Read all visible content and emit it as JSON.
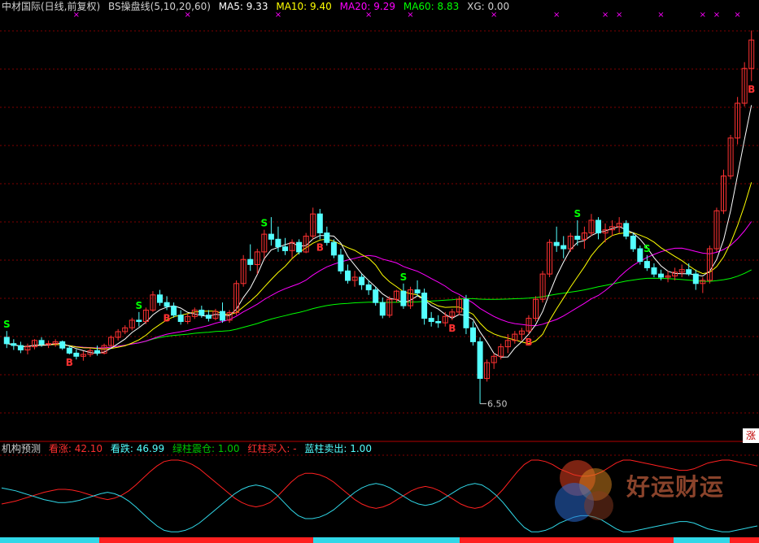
{
  "header": {
    "stock": "中材国际(日线,前复权)",
    "indicator": "BS操盘线(5,10,20,60)",
    "ma5": "MA5: 9.33",
    "ma10": "MA10: 9.40",
    "ma20": "MA20: 9.29",
    "ma60": "MA60: 8.83",
    "xg": "XG: 0.00"
  },
  "subpanel": {
    "title": "机构预测",
    "kanzhang": "看涨: 42.10",
    "kandie": "看跌: 46.99",
    "green_bar": "绿柱震仓: 1.00",
    "red_bar": "红柱买入: -",
    "blue_bar": "蓝柱卖出: 1.00"
  },
  "annotations": {
    "low_price": "6.50",
    "buy_label": "B",
    "sell_label": "S",
    "x_mark": "×",
    "zhang_button": "涨"
  },
  "watermark": {
    "text": "好运财运"
  },
  "colors": {
    "up": "#ff3232",
    "down": "#54ffff",
    "ma5": "#ffffff",
    "ma10": "#ffff00",
    "ma20": "#ff00ff",
    "ma60": "#00ff00",
    "label_b": "#ff3232",
    "label_s": "#00ff00",
    "grid": "#800000",
    "sub_red": "#ff2020",
    "sub_blue": "#30d8e8"
  },
  "chart_data": {
    "type": "candlestick",
    "price_range": [
      6.2,
      12.6
    ],
    "low_marker": 6.5,
    "ohlc": [
      [
        7.55,
        7.65,
        7.38,
        7.45
      ],
      [
        7.45,
        7.52,
        7.35,
        7.42
      ],
      [
        7.42,
        7.48,
        7.3,
        7.35
      ],
      [
        7.35,
        7.45,
        7.28,
        7.4
      ],
      [
        7.4,
        7.52,
        7.36,
        7.5
      ],
      [
        7.5,
        7.55,
        7.4,
        7.44
      ],
      [
        7.44,
        7.5,
        7.38,
        7.45
      ],
      [
        7.45,
        7.52,
        7.4,
        7.48
      ],
      [
        7.48,
        7.5,
        7.35,
        7.38
      ],
      [
        7.38,
        7.42,
        7.28,
        7.3
      ],
      [
        7.3,
        7.36,
        7.2,
        7.25
      ],
      [
        7.25,
        7.33,
        7.18,
        7.28
      ],
      [
        7.28,
        7.38,
        7.24,
        7.34
      ],
      [
        7.34,
        7.42,
        7.26,
        7.3
      ],
      [
        7.3,
        7.45,
        7.28,
        7.42
      ],
      [
        7.42,
        7.58,
        7.4,
        7.55
      ],
      [
        7.55,
        7.68,
        7.5,
        7.64
      ],
      [
        7.64,
        7.74,
        7.6,
        7.7
      ],
      [
        7.7,
        7.86,
        7.66,
        7.82
      ],
      [
        7.82,
        7.95,
        7.72,
        7.8
      ],
      [
        7.8,
        8.02,
        7.76,
        7.98
      ],
      [
        7.98,
        8.28,
        7.95,
        8.22
      ],
      [
        8.22,
        8.3,
        8.05,
        8.1
      ],
      [
        8.1,
        8.2,
        7.98,
        8.04
      ],
      [
        8.04,
        8.1,
        7.86,
        7.9
      ],
      [
        7.9,
        7.98,
        7.75,
        7.8
      ],
      [
        7.8,
        7.92,
        7.76,
        7.88
      ],
      [
        7.88,
        8.02,
        7.84,
        7.98
      ],
      [
        7.98,
        8.05,
        7.86,
        7.9
      ],
      [
        7.9,
        7.98,
        7.8,
        7.85
      ],
      [
        7.85,
        8.0,
        7.82,
        7.96
      ],
      [
        7.96,
        8.1,
        7.78,
        7.82
      ],
      [
        7.82,
        7.98,
        7.78,
        7.94
      ],
      [
        7.94,
        8.45,
        7.9,
        8.4
      ],
      [
        8.4,
        8.85,
        8.35,
        8.78
      ],
      [
        8.78,
        9.02,
        8.6,
        8.7
      ],
      [
        8.7,
        8.95,
        8.55,
        8.9
      ],
      [
        8.9,
        9.25,
        8.8,
        9.18
      ],
      [
        9.18,
        9.45,
        9.0,
        9.1
      ],
      [
        9.1,
        9.3,
        8.9,
        8.98
      ],
      [
        8.98,
        9.12,
        8.85,
        8.92
      ],
      [
        8.92,
        9.1,
        8.8,
        9.05
      ],
      [
        9.05,
        9.1,
        8.86,
        8.9
      ],
      [
        8.9,
        9.2,
        8.88,
        9.15
      ],
      [
        9.15,
        9.6,
        9.1,
        9.5
      ],
      [
        9.5,
        9.58,
        9.1,
        9.2
      ],
      [
        9.2,
        9.3,
        9.0,
        9.05
      ],
      [
        9.05,
        9.1,
        8.8,
        8.85
      ],
      [
        8.85,
        8.95,
        8.55,
        8.6
      ],
      [
        8.6,
        8.7,
        8.4,
        8.45
      ],
      [
        8.45,
        8.6,
        8.35,
        8.5
      ],
      [
        8.5,
        8.55,
        8.3,
        8.38
      ],
      [
        8.38,
        8.45,
        8.22,
        8.3
      ],
      [
        8.3,
        8.35,
        8.05,
        8.1
      ],
      [
        8.1,
        8.18,
        7.85,
        7.9
      ],
      [
        7.9,
        8.2,
        7.86,
        8.15
      ],
      [
        8.15,
        8.3,
        8.1,
        8.28
      ],
      [
        8.28,
        8.4,
        8.0,
        8.05
      ],
      [
        8.05,
        8.35,
        8.0,
        8.3
      ],
      [
        8.3,
        8.45,
        8.2,
        8.25
      ],
      [
        8.25,
        8.32,
        7.75,
        7.85
      ],
      [
        7.85,
        7.95,
        7.72,
        7.8
      ],
      [
        7.8,
        7.9,
        7.7,
        7.78
      ],
      [
        7.78,
        7.95,
        7.72,
        7.88
      ],
      [
        7.88,
        8.0,
        7.82,
        7.95
      ],
      [
        7.95,
        8.2,
        7.9,
        8.15
      ],
      [
        8.15,
        8.22,
        7.6,
        7.7
      ],
      [
        7.7,
        7.8,
        7.42,
        7.48
      ],
      [
        7.48,
        7.55,
        6.5,
        6.9
      ],
      [
        6.9,
        7.2,
        6.85,
        7.15
      ],
      [
        7.15,
        7.3,
        7.05,
        7.25
      ],
      [
        7.25,
        7.45,
        7.2,
        7.4
      ],
      [
        7.4,
        7.6,
        7.3,
        7.5
      ],
      [
        7.5,
        7.65,
        7.45,
        7.6
      ],
      [
        7.6,
        7.7,
        7.5,
        7.65
      ],
      [
        7.65,
        7.9,
        7.6,
        7.85
      ],
      [
        7.85,
        8.2,
        7.8,
        8.15
      ],
      [
        8.15,
        8.6,
        8.1,
        8.55
      ],
      [
        8.55,
        9.1,
        8.5,
        9.05
      ],
      [
        9.05,
        9.3,
        8.9,
        9.0
      ],
      [
        9.0,
        9.15,
        8.8,
        8.95
      ],
      [
        8.95,
        9.2,
        8.9,
        9.15
      ],
      [
        9.15,
        9.4,
        9.0,
        9.1
      ],
      [
        9.1,
        9.3,
        8.95,
        9.2
      ],
      [
        9.2,
        9.5,
        9.15,
        9.4
      ],
      [
        9.4,
        9.45,
        9.1,
        9.2
      ],
      [
        9.2,
        9.35,
        9.05,
        9.25
      ],
      [
        9.25,
        9.4,
        9.15,
        9.3
      ],
      [
        9.3,
        9.45,
        9.2,
        9.35
      ],
      [
        9.35,
        9.4,
        9.1,
        9.15
      ],
      [
        9.15,
        9.2,
        8.9,
        8.95
      ],
      [
        8.95,
        9.0,
        8.7,
        8.75
      ],
      [
        8.75,
        8.85,
        8.6,
        8.65
      ],
      [
        8.65,
        8.72,
        8.5,
        8.55
      ],
      [
        8.55,
        8.62,
        8.45,
        8.5
      ],
      [
        8.5,
        8.6,
        8.42,
        8.52
      ],
      [
        8.52,
        8.65,
        8.45,
        8.58
      ],
      [
        8.58,
        8.7,
        8.5,
        8.62
      ],
      [
        8.62,
        8.72,
        8.52,
        8.55
      ],
      [
        8.55,
        8.62,
        8.3,
        8.4
      ],
      [
        8.4,
        8.5,
        8.25,
        8.45
      ],
      [
        8.45,
        9.0,
        8.4,
        8.95
      ],
      [
        8.95,
        9.6,
        8.9,
        9.55
      ],
      [
        9.55,
        10.2,
        9.5,
        10.1
      ],
      [
        10.1,
        10.75,
        10.05,
        10.7
      ],
      [
        10.7,
        11.35,
        10.6,
        11.25
      ],
      [
        11.25,
        11.9,
        11.2,
        11.8
      ],
      [
        11.8,
        12.4,
        11.6,
        12.25
      ]
    ],
    "ma5_last": 9.33,
    "ma10_last": 9.4,
    "ma20_last": 9.29,
    "ma60_last": 8.83,
    "sub": {
      "red": [
        40,
        42,
        44,
        47,
        50,
        53,
        56,
        58,
        60,
        60,
        59,
        57,
        54,
        51,
        48,
        46,
        48,
        52,
        58,
        66,
        75,
        84,
        92,
        98,
        100,
        100,
        98,
        94,
        88,
        80,
        72,
        64,
        56,
        48,
        42,
        38,
        36,
        38,
        42,
        50,
        60,
        70,
        78,
        82,
        82,
        80,
        76,
        70,
        62,
        54,
        46,
        40,
        36,
        34,
        36,
        40,
        46,
        52,
        58,
        62,
        64,
        62,
        58,
        52,
        46,
        40,
        36,
        34,
        36,
        42,
        50,
        60,
        72,
        84,
        94,
        100,
        100,
        98,
        94,
        88,
        84,
        80,
        78,
        78,
        80,
        84,
        90,
        96,
        100,
        100,
        98,
        96,
        94,
        92,
        90,
        88,
        86,
        86,
        88,
        92,
        96,
        98,
        100,
        100,
        98,
        96,
        94,
        92
      ],
      "blue": [
        62,
        60,
        58,
        55,
        52,
        49,
        46,
        44,
        42,
        42,
        43,
        45,
        48,
        51,
        54,
        56,
        54,
        50,
        44,
        36,
        27,
        18,
        10,
        4,
        2,
        2,
        4,
        8,
        14,
        22,
        30,
        38,
        46,
        54,
        60,
        64,
        66,
        64,
        60,
        52,
        42,
        32,
        24,
        20,
        20,
        22,
        26,
        32,
        40,
        48,
        56,
        62,
        66,
        68,
        66,
        62,
        56,
        50,
        44,
        40,
        38,
        40,
        44,
        50,
        56,
        62,
        66,
        68,
        66,
        60,
        52,
        42,
        30,
        18,
        8,
        2,
        2,
        4,
        8,
        14,
        18,
        22,
        24,
        24,
        22,
        18,
        12,
        6,
        2,
        2,
        4,
        6,
        8,
        10,
        12,
        14,
        16,
        16,
        14,
        10,
        6,
        4,
        2,
        2,
        4,
        6,
        8,
        10
      ],
      "range": [
        0,
        100
      ],
      "bars": [
        [
          "blue",
          0,
          122
        ],
        [
          "red",
          122,
          385
        ],
        [
          "blue",
          385,
          565
        ],
        [
          "red",
          565,
          828
        ],
        [
          "blue",
          828,
          897
        ],
        [
          "red",
          897,
          933
        ]
      ]
    }
  }
}
